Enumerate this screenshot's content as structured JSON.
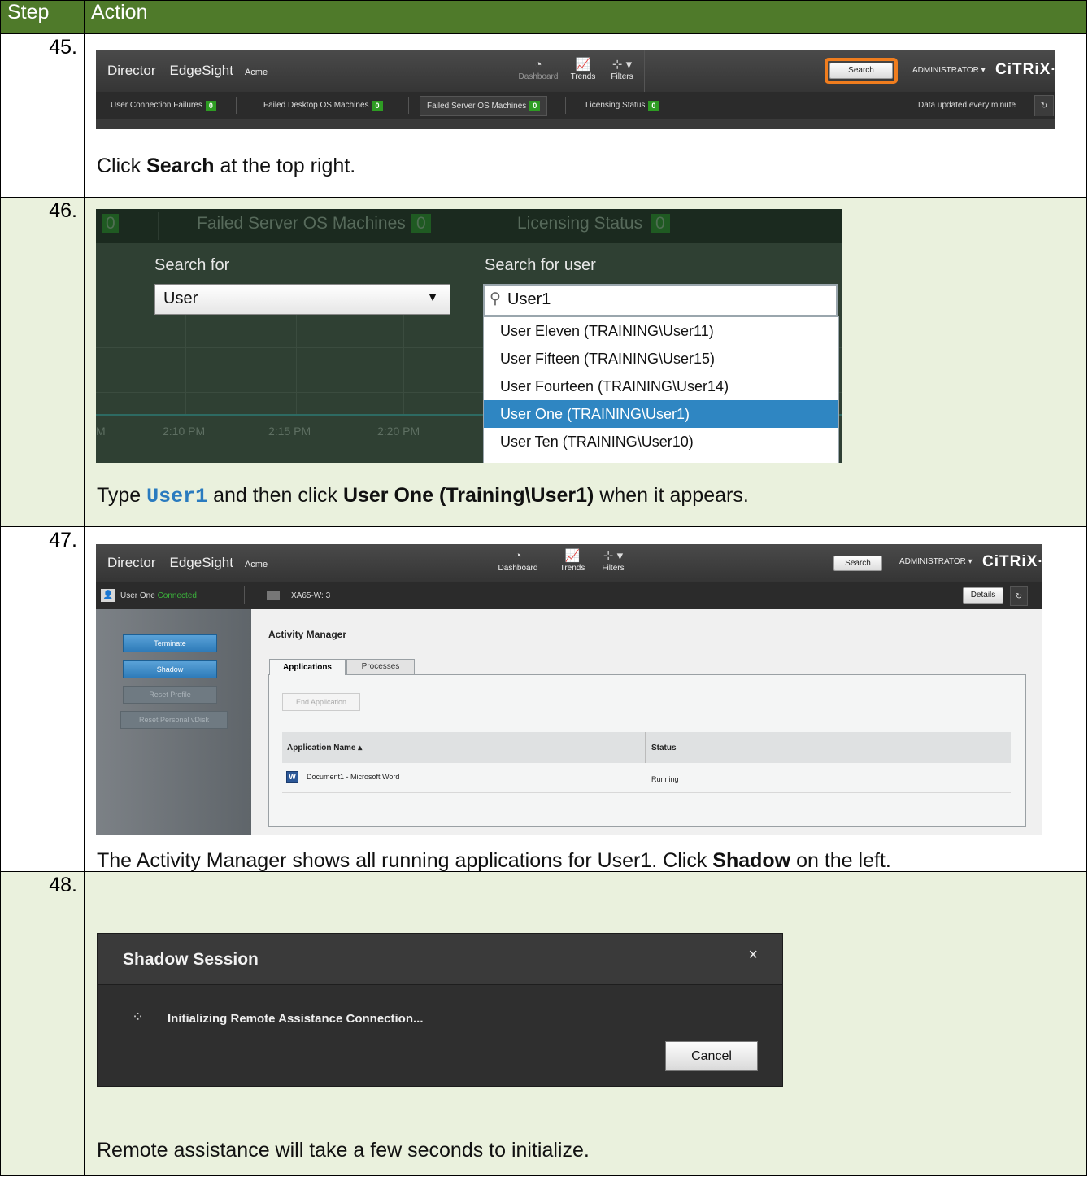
{
  "header": {
    "step": "Step",
    "action": "Action"
  },
  "steps": [
    {
      "num": "45.",
      "caption": {
        "pre": "Click ",
        "bold": "Search",
        "post": " at the top right."
      },
      "ui": {
        "brand1": "Director",
        "brand2": "EdgeSight",
        "tenant": "Acme",
        "nav": [
          "Dashboard",
          "Trends",
          "Filters"
        ],
        "search": "Search",
        "admin": "ADMINISTRATOR ▾",
        "logo": "CiTRiX·",
        "status": [
          {
            "label": "User Connection Failures",
            "count": "0"
          },
          {
            "label": "Failed Desktop OS Machines",
            "count": "0"
          },
          {
            "label": "Failed Server OS Machines",
            "count": "0"
          },
          {
            "label": "Licensing Status",
            "count": "0"
          }
        ],
        "updated": "Data updated every minute",
        "highlight_color": "#f07d1e"
      }
    },
    {
      "num": "46.",
      "caption": {
        "pre": "Type ",
        "code": "User1",
        "mid": " and then click ",
        "bold": "User One (Training\\User1)",
        "post": " when it appears."
      },
      "ui": {
        "strip": {
          "count1": "0",
          "failed": "Failed Server OS Machines",
          "count2": "0",
          "licensing": "Licensing Status",
          "count3": "0"
        },
        "search_for": "Search for",
        "search_for_user": "Search for user",
        "dropdown_value": "User",
        "input_value": "User1",
        "options": [
          "User Eleven (TRAINING\\User11)",
          "User Fifteen (TRAINING\\User15)",
          "User Fourteen (TRAINING\\User14)",
          "User One (TRAINING\\User1)",
          "User Ten (TRAINING\\User10)"
        ],
        "selected_index": 3,
        "ticks": [
          "2:10 PM",
          "2:15 PM",
          "2:20 PM"
        ]
      }
    },
    {
      "num": "47.",
      "caption": {
        "pre": "The Activity Manager shows all running applications for User1. Click ",
        "bold": "Shadow",
        "post": " on the left."
      },
      "ui": {
        "brand1": "Director",
        "brand2": "EdgeSight",
        "tenant": "Acme",
        "nav": [
          "Dashboard",
          "Trends",
          "Filters"
        ],
        "search": "Search",
        "admin": "ADMINISTRATOR ▾",
        "logo": "CiTRiX·",
        "user": "User One",
        "user_status": "Connected",
        "machine": "XA65-W: 3",
        "details": "Details",
        "actions": [
          "Terminate",
          "Shadow",
          "Reset Profile",
          "Reset Personal vDisk"
        ],
        "title": "Activity Manager",
        "tabs": [
          "Applications",
          "Processes"
        ],
        "end_app": "End Application",
        "col_app": "Application Name ▴",
        "col_status": "Status",
        "app_name": "Document1 - Microsoft Word",
        "app_status": "Running",
        "app_icon": "W"
      }
    },
    {
      "num": "48.",
      "caption": {
        "text": "Remote assistance will take a few seconds to initialize."
      },
      "ui": {
        "title": "Shadow Session",
        "close": "×",
        "message": "Initializing Remote Assistance Connection...",
        "cancel": "Cancel"
      }
    }
  ]
}
